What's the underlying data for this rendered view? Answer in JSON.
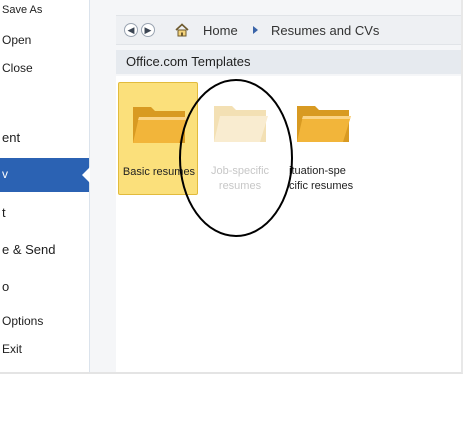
{
  "sidebar": {
    "items": [
      {
        "label": "Save As"
      },
      {
        "label": "Open"
      },
      {
        "label": "Close"
      },
      {
        "label": "ent"
      },
      {
        "label": "v"
      },
      {
        "label": "t"
      },
      {
        "label": "e & Send"
      },
      {
        "label": "o"
      },
      {
        "label": "Options"
      },
      {
        "label": "Exit"
      }
    ]
  },
  "toolbar": {
    "back_icon": "back-arrow-icon",
    "forward_icon": "forward-arrow-icon",
    "breadcrumb": [
      "Home",
      "Resumes and CVs"
    ]
  },
  "section": {
    "title": "Office.com Templates"
  },
  "tiles": [
    {
      "label": "Basic resumes",
      "icon": "folder-icon"
    },
    {
      "label_line1": "Job-specific",
      "label_line2": "resumes",
      "icon": "folder-icon"
    },
    {
      "label_line1": "ituation-spe",
      "label_line2": "cific resumes",
      "icon": "folder-icon"
    }
  ],
  "colors": {
    "selected_menu": "#2b62b3",
    "folder": "#f2b53a",
    "selected_tile": "#fbe07b"
  }
}
